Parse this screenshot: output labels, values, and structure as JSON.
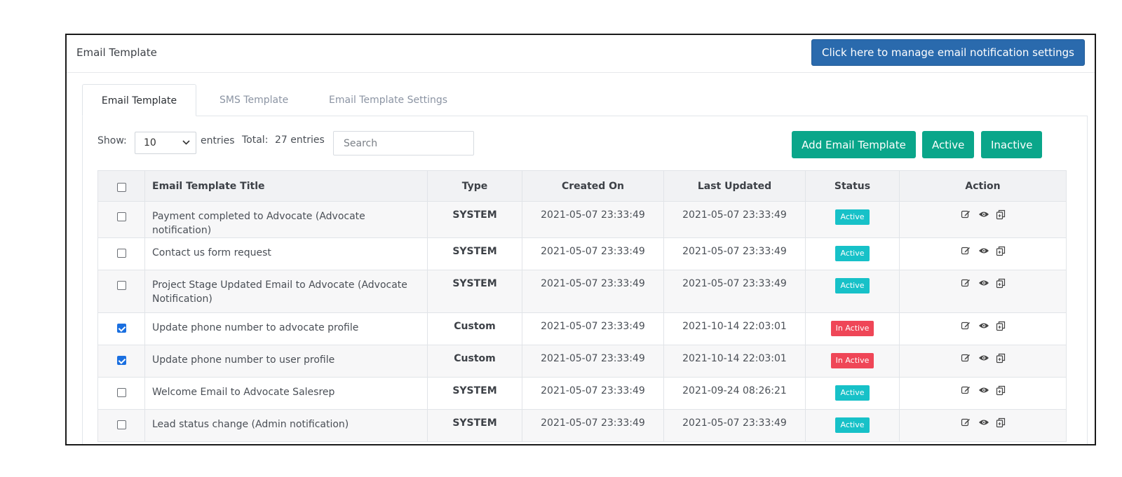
{
  "header": {
    "title": "Email Template",
    "manage_button": "Click here to manage email notification settings"
  },
  "tabs": [
    {
      "label": "Email Template",
      "active": true
    },
    {
      "label": "SMS Template",
      "active": false
    },
    {
      "label": "Email Template Settings",
      "active": false
    }
  ],
  "toolbar": {
    "show_label": "Show:",
    "show_value": "10",
    "entries_label": "entries",
    "total_label": "Total:",
    "total_value": "27 entries",
    "search_placeholder": "Search",
    "add_button": "Add Email Template",
    "active_button": "Active",
    "inactive_button": "Inactive"
  },
  "table": {
    "columns": [
      "Email Template Title",
      "Type",
      "Created On",
      "Last Updated",
      "Status",
      "Action"
    ],
    "rows": [
      {
        "title": "Payment completed to Advocate (Advocate notification)",
        "type": "SYSTEM",
        "created": "2021-05-07 23:33:49",
        "updated": "2021-05-07 23:33:49",
        "status": "Active",
        "checked": false
      },
      {
        "title": "Contact us form request",
        "type": "SYSTEM",
        "created": "2021-05-07 23:33:49",
        "updated": "2021-05-07 23:33:49",
        "status": "Active",
        "checked": false
      },
      {
        "title": "Project Stage Updated Email to Advocate (Advocate Notification)",
        "type": "SYSTEM",
        "created": "2021-05-07 23:33:49",
        "updated": "2021-05-07 23:33:49",
        "status": "Active",
        "checked": false
      },
      {
        "title": "Update phone number to advocate profile",
        "type": "Custom",
        "created": "2021-05-07 23:33:49",
        "updated": "2021-10-14 22:03:01",
        "status": "In Active",
        "checked": true
      },
      {
        "title": "Update phone number to user profile",
        "type": "Custom",
        "created": "2021-05-07 23:33:49",
        "updated": "2021-10-14 22:03:01",
        "status": "In Active",
        "checked": true
      },
      {
        "title": "Welcome Email to Advocate Salesrep",
        "type": "SYSTEM",
        "created": "2021-05-07 23:33:49",
        "updated": "2021-09-24 08:26:21",
        "status": "Active",
        "checked": false
      },
      {
        "title": "Lead status change (Admin notification)",
        "type": "SYSTEM",
        "created": "2021-05-07 23:33:49",
        "updated": "2021-05-07 23:33:49",
        "status": "Active",
        "checked": false
      }
    ]
  },
  "colors": {
    "primary_blue": "#2a6aad",
    "green": "#0aa68a",
    "badge_active": "#17c1c8",
    "badge_inactive": "#ef4657",
    "checkbox_checked": "#1a6fe0"
  },
  "icons": {
    "row_actions": [
      "edit-icon",
      "view-icon",
      "copy-icon"
    ],
    "select": "chevron-down-icon"
  }
}
